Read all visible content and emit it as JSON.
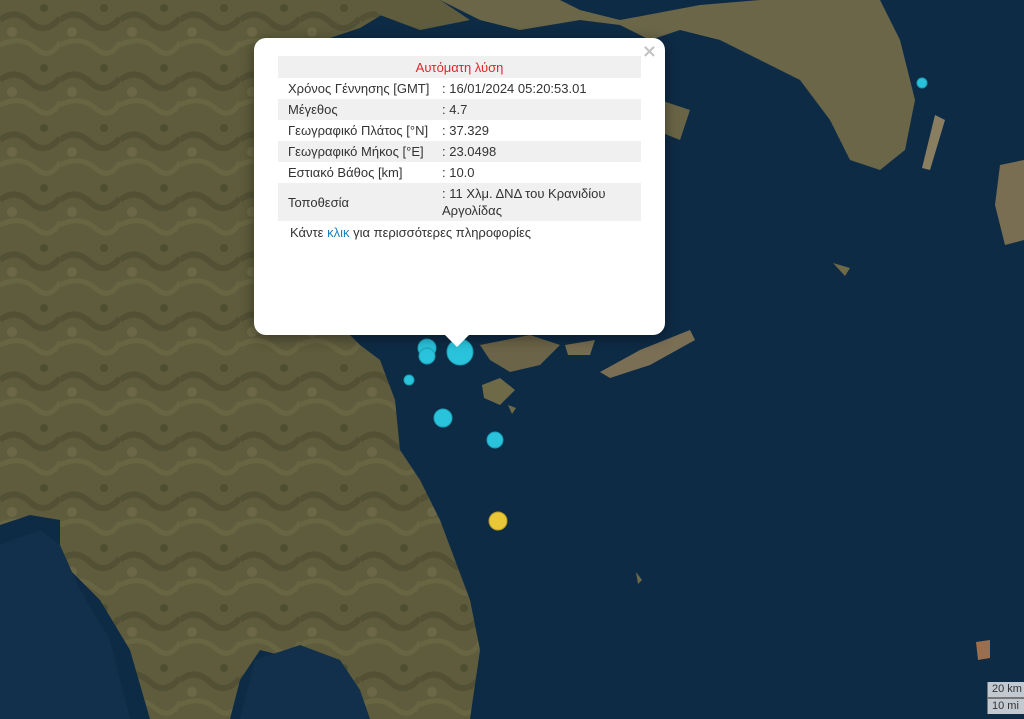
{
  "popup": {
    "title": "Αυτόματη λύση",
    "rows": [
      {
        "label": "Χρόνος Γέννησης [GMT]",
        "value": ": 16/01/2024 05:20:53.01"
      },
      {
        "label": "Μέγεθος",
        "value": ": 4.7"
      },
      {
        "label": "Γεωγραφικό Πλάτος [°N]",
        "value": ": 37.329"
      },
      {
        "label": "Γεωγραφικό Μήκος [°E]",
        "value": ": 23.0498"
      },
      {
        "label": "Εστιακό Βάθος [km]",
        "value": ": 10.0"
      },
      {
        "label": "Τοποθεσία",
        "value": ": 11 Χλμ. ΔΝΔ του Κρανιδίου Αργολίδας"
      }
    ],
    "more_prefix": "Κάντε ",
    "more_link": "κλικ",
    "more_suffix": " για περισσότερες πληροφορίες",
    "close_glyph": "×"
  },
  "scale": {
    "top_label": "20 km",
    "bottom_label": "10 mi"
  },
  "colors": {
    "sea": "#0e2b45",
    "land": "#5b5a3a",
    "quake_recent": "#29c3dc",
    "quake_older": "#e8c838",
    "title_red": "#e0262a",
    "link_blue": "#1a7fc1"
  }
}
